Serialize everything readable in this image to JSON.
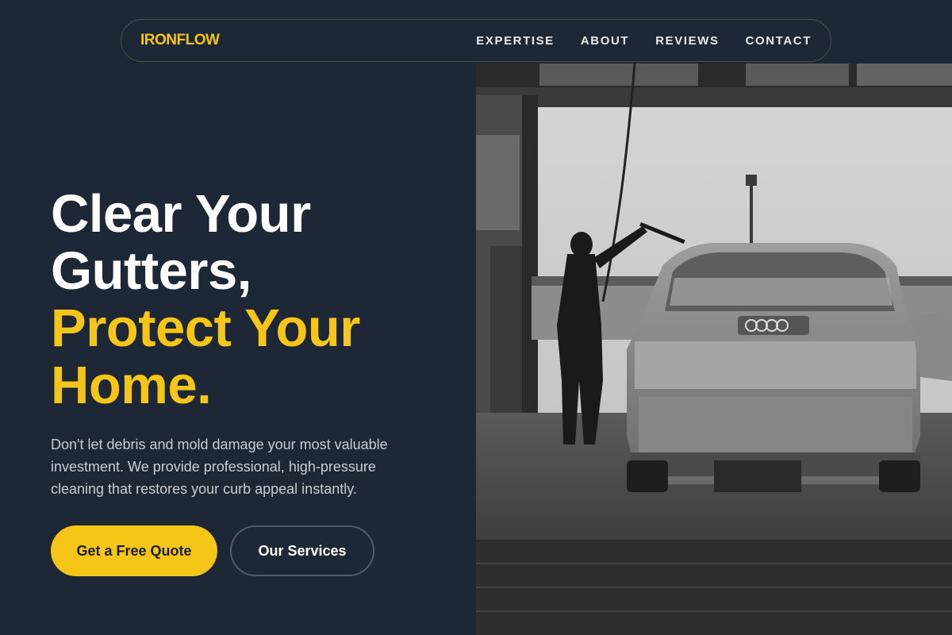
{
  "brand": {
    "logo": "IRONFLOW"
  },
  "nav": {
    "items": [
      {
        "label": "EXPERTISE"
      },
      {
        "label": "ABOUT"
      },
      {
        "label": "REVIEWS"
      },
      {
        "label": "CONTACT"
      }
    ]
  },
  "hero": {
    "headline_line1": "Clear Your",
    "headline_line2": "Gutters,",
    "headline_line3": "Protect Your",
    "headline_line4": "Home.",
    "description": "Don't let debris and mold damage your most valuable investment. We provide professional, high-pressure cleaning that restores your curb appeal instantly.",
    "primary_button": "Get a Free Quote",
    "secondary_button": "Our Services"
  },
  "colors": {
    "background": "#1e2735",
    "accent": "#f5c518",
    "text_primary": "#ffffff",
    "text_secondary": "#c9ccd2"
  },
  "image": {
    "subject": "person pressure-washing a car in a black-and-white photo"
  }
}
